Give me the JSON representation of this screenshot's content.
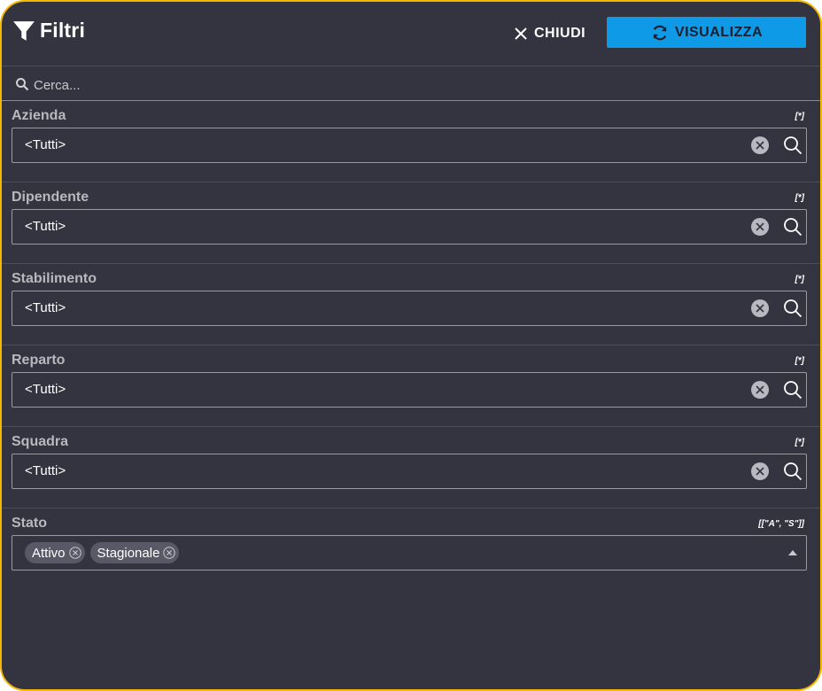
{
  "header": {
    "title": "Filtri",
    "close_label": "CHIUDI",
    "view_label": "VISUALIZZA",
    "icons": {
      "filter": "filter-icon",
      "close": "close-icon",
      "refresh": "refresh-icon"
    }
  },
  "search": {
    "placeholder": "Cerca...",
    "value": ""
  },
  "filters": [
    {
      "label": "Azienda",
      "code": "[*]",
      "value": "<Tutti>"
    },
    {
      "label": "Dipendente",
      "code": "[*]",
      "value": "<Tutti>"
    },
    {
      "label": "Stabilimento",
      "code": "[*]",
      "value": "<Tutti>"
    },
    {
      "label": "Reparto",
      "code": "[*]",
      "value": "<Tutti>"
    },
    {
      "label": "Squadra",
      "code": "[*]",
      "value": "<Tutti>"
    }
  ],
  "stato": {
    "label": "Stato",
    "code": "[[\"A\", \"S\"]]",
    "chips": [
      {
        "label": "Attivo"
      },
      {
        "label": "Stagionale"
      }
    ]
  },
  "colors": {
    "accent": "#0f9ae8",
    "frame_border": "#f5b800",
    "background": "#343440"
  }
}
